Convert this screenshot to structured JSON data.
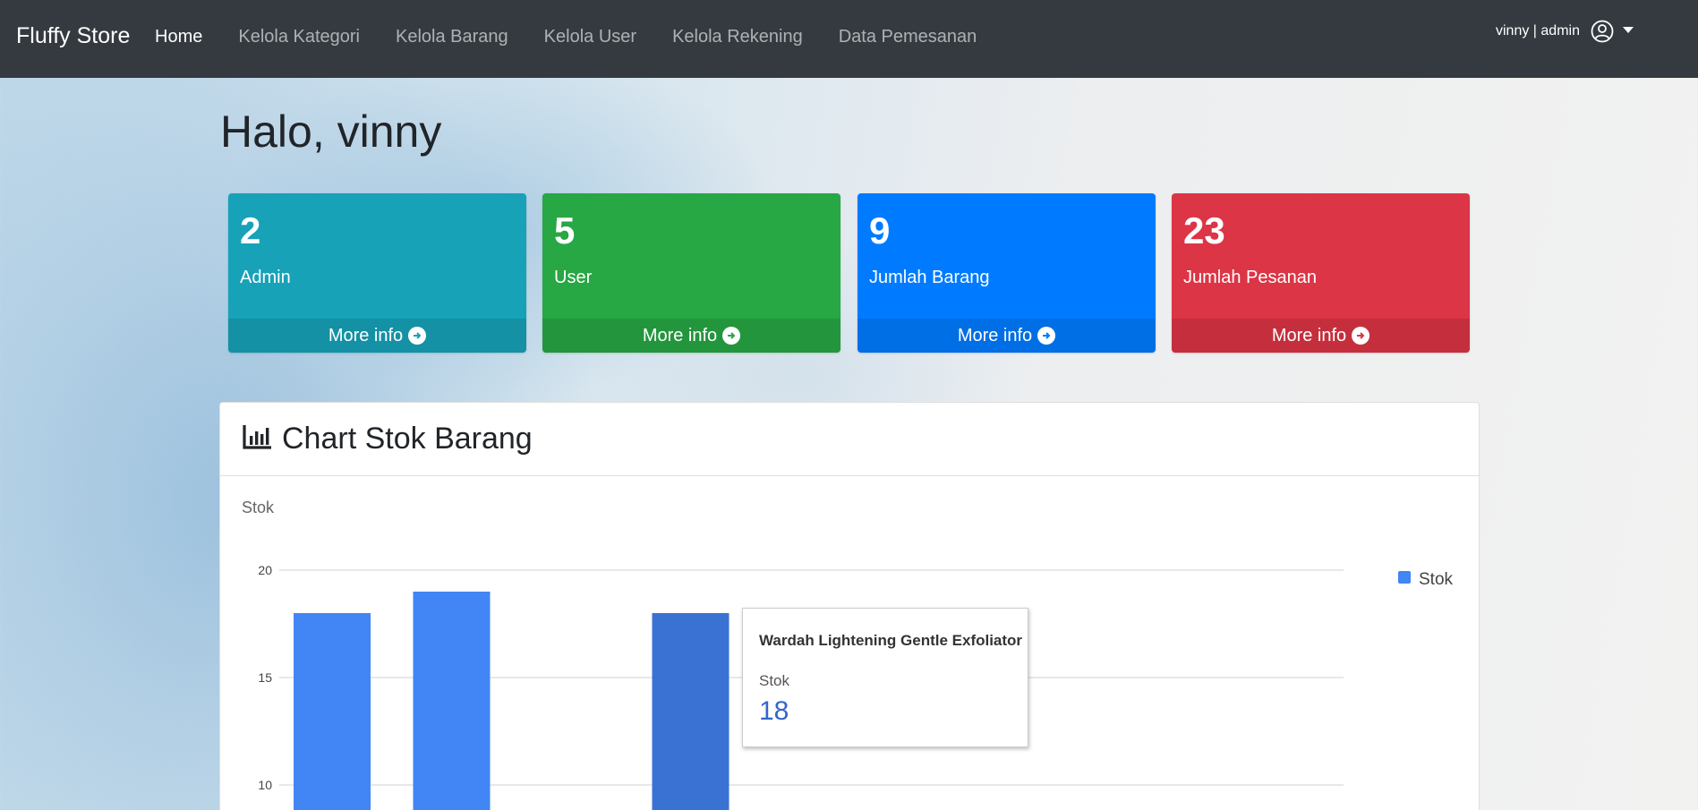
{
  "navbar": {
    "brand": "Fluffy Store",
    "links": [
      "Home",
      "Kelola Kategori",
      "Kelola Barang",
      "Kelola User",
      "Kelola Rekening",
      "Data Pemesanan"
    ],
    "user_text": "vinny | admin"
  },
  "greeting": "Halo, vinny",
  "stats": [
    {
      "value": "2",
      "label": "Admin",
      "footer": "More info",
      "color": "#17a2b8"
    },
    {
      "value": "5",
      "label": "User",
      "footer": "More info",
      "color": "#28a745"
    },
    {
      "value": "9",
      "label": "Jumlah Barang",
      "footer": "More info",
      "color": "#007bff"
    },
    {
      "value": "23",
      "label": "Jumlah Pesanan",
      "footer": "More info",
      "color": "#dc3545"
    }
  ],
  "card": {
    "title": "Chart Stok Barang",
    "icon": "chart-bar-icon"
  },
  "chart_data": {
    "type": "bar",
    "ylabel": "Stok",
    "yticks": [
      10,
      15,
      20
    ],
    "ylim": [
      0,
      20
    ],
    "legend": "right",
    "series": [
      {
        "name": "Stok",
        "color": "#4285f4",
        "values": [
          18,
          19,
          null,
          18
        ]
      }
    ],
    "highlighted_index": 3,
    "highlight_color": "#3a72d3",
    "tooltip": {
      "title": "Wardah Lightening Gentle Exfoliator",
      "series": "Stok",
      "value": "18"
    }
  }
}
